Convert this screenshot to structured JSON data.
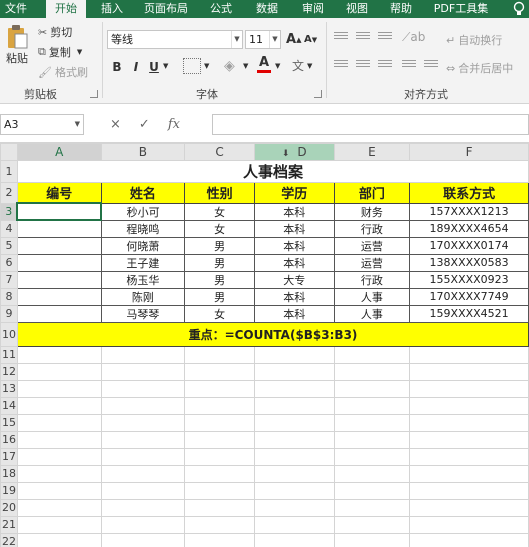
{
  "tabs": [
    "文件",
    "开始",
    "插入",
    "页面布局",
    "公式",
    "数据",
    "审阅",
    "视图",
    "帮助",
    "PDF工具集"
  ],
  "active_tab": "开始",
  "clipboard": {
    "paste_label": "粘贴",
    "cut_label": "剪切",
    "copy_label": "复制",
    "format_painter_label": "格式刷",
    "group_label": "剪贴板"
  },
  "font": {
    "name": "等线",
    "size": "11",
    "grow_label": "A",
    "shrink_label": "A",
    "bold": "B",
    "italic": "I",
    "underline": "U",
    "color_letter": "A",
    "color_accent": "#e00000",
    "group_label": "字体"
  },
  "alignment": {
    "wrap_label": "自动换行",
    "merge_label": "合并后居中",
    "group_label": "对齐方式"
  },
  "formula_bar": {
    "name_box": "A3",
    "cancel_icon": "×",
    "enter_icon": "✓",
    "fx_label": "fx",
    "formula": ""
  },
  "columns": [
    "A",
    "B",
    "C",
    "D",
    "E",
    "F"
  ],
  "rows": [
    "1",
    "2",
    "3",
    "4",
    "5",
    "6",
    "7",
    "8",
    "9",
    "10",
    "11",
    "12",
    "13",
    "14",
    "15",
    "16",
    "17",
    "18",
    "19",
    "20",
    "21",
    "22"
  ],
  "sheet": {
    "title": "人事档案",
    "headers": [
      "编号",
      "姓名",
      "性别",
      "学历",
      "部门",
      "联系方式"
    ],
    "records": [
      [
        "",
        "秒小可",
        "女",
        "本科",
        "财务",
        "157XXXX1213"
      ],
      [
        "",
        "程晓鸣",
        "女",
        "本科",
        "行政",
        "189XXXX4654"
      ],
      [
        "",
        "何晓萧",
        "男",
        "本科",
        "运营",
        "170XXXX0174"
      ],
      [
        "",
        "王子建",
        "男",
        "本科",
        "运营",
        "138XXXX0583"
      ],
      [
        "",
        "杨玉华",
        "男",
        "大专",
        "行政",
        "155XXXX0923"
      ],
      [
        "",
        "陈刚",
        "男",
        "本科",
        "人事",
        "170XXXX7749"
      ],
      [
        "",
        "马琴琴",
        "女",
        "本科",
        "人事",
        "159XXXX4521"
      ]
    ],
    "note": "重点：=COUNTA($B$3:B3)"
  },
  "colors": {
    "excel_green": "#217346",
    "highlight_yellow": "#ffff00"
  }
}
